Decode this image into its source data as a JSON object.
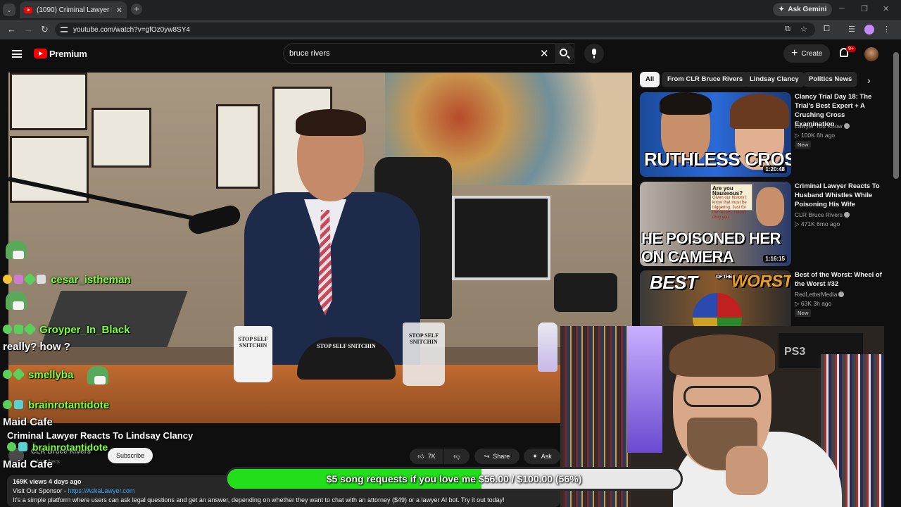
{
  "browser": {
    "tab_title": "(1090) Criminal Lawyer Reacts To",
    "url": "youtube.com/watch?v=gfOz0yw8SY4",
    "gemini_label": "Ask Gemini"
  },
  "header": {
    "logo_text": "Premium",
    "search_value": "bruce rivers",
    "create_label": "Create",
    "notification_count": "9+"
  },
  "video": {
    "mug_text": "STOP SELF SNITCHIN",
    "hat_text": "STOP SELF SNITCHIN"
  },
  "chat": [
    {
      "name": "cesar_istheman",
      "message": ""
    },
    {
      "name": "Groyper_In_Black",
      "message": ""
    },
    {
      "name": "",
      "message": "really? how ?"
    },
    {
      "name": "smellyba",
      "message": ""
    },
    {
      "name": "brainrotantidote",
      "message": ""
    },
    {
      "name": "",
      "message": "Maid Cafe"
    },
    {
      "name": "brainrotantidote",
      "message": ""
    },
    {
      "name": "",
      "message": "Maid Cafe"
    }
  ],
  "watch": {
    "title": "Criminal Lawyer Reacts To Lindsay Clancy",
    "channel": "CLR Bruce Rivers",
    "subs": "subscribers",
    "subscribe_label": "Subscribe",
    "likes": "7K",
    "share_label": "Share",
    "ask_label": "Ask",
    "description": {
      "meta": "169K views  4 days ago",
      "sponsor_label": "Visit Our Sponsor - ",
      "sponsor_link": "https://AskaLawyer.com",
      "body": "It's a simple platform where users can ask legal questions and get an answer, depending on whether they want to chat with an attorney ($49) or a lawyer AI bot. Try it out today!"
    }
  },
  "sidebar": {
    "chips": [
      "All",
      "From CLR Bruce Rivers",
      "Lindsay Clancy",
      "Politics News"
    ],
    "recommendations": [
      {
        "title": "Clancy Trial Day 18: The Trial's Best Expert + A Crushing Cross Examination",
        "channel": "Lawyer You Know",
        "meta": "100K  6h ago",
        "badge": "New",
        "duration": "1:20:48",
        "thumb_text": "RUTHLESS CROSS"
      },
      {
        "title": "Criminal Lawyer Reacts To Husband Whistles While Poisoning His Wife",
        "channel": "CLR Bruce Rivers",
        "meta": "471K  6mo ago",
        "badge": "",
        "duration": "1:16:15",
        "thumb_text_1": "HE POISONED HER",
        "thumb_text_2": "ON CAMERA",
        "note_1": "Are you Nauseous?",
        "note_2": "Given our history I know that must be triggering. Just for the record, I didn't drug you."
      },
      {
        "title": "Best of the Worst: Wheel of the Worst #32",
        "channel": "RedLetterMedia",
        "meta": "63K  3h ago",
        "badge": "New",
        "thumb_text_1": "BEST",
        "thumb_text_2": "OF THE",
        "thumb_text_3": "WORST"
      }
    ]
  },
  "webcam": {
    "console_label": "PS3"
  },
  "goal": {
    "text": "$5 song requests if you love me $56.00 / $100.00 (56%)",
    "progress": 0.56
  }
}
